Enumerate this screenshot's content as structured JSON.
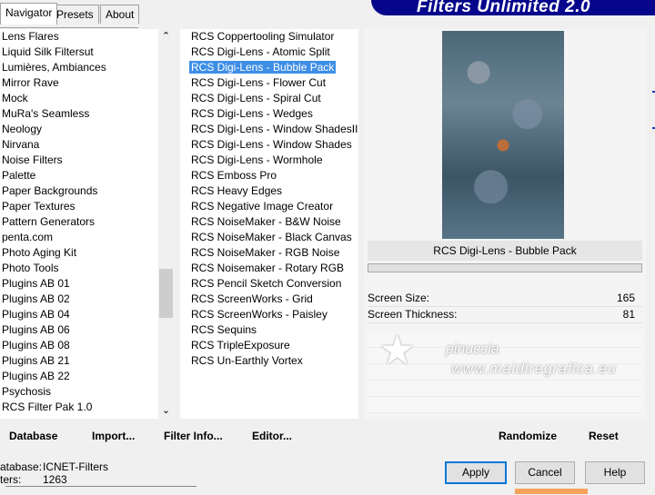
{
  "window": {
    "banner_title": "Filters Unlimited 2.0"
  },
  "tabs": [
    {
      "label": "Navigator",
      "active": true
    },
    {
      "label": "Presets",
      "active": false
    },
    {
      "label": "About",
      "active": false
    }
  ],
  "categories": [
    "Lens Flares",
    "Liquid Silk Filtersut",
    "Lumières, Ambiances",
    "Mirror Rave",
    "Mock",
    "MuRa's Seamless",
    "Neology",
    "Nirvana",
    "Noise Filters",
    "Palette",
    "Paper Backgrounds",
    "Paper Textures",
    "Pattern Generators",
    "penta.com",
    "Photo Aging Kit",
    "Photo Tools",
    "Plugins AB 01",
    "Plugins AB 02",
    "Plugins AB 04",
    "Plugins AB 06",
    "Plugins AB 08",
    "Plugins AB 21",
    "Plugins AB 22",
    "Psychosis",
    "RCS Filter Pak 1.0"
  ],
  "filters": [
    "RCS Coppertooling Simulator",
    "RCS Digi-Lens - Atomic Split",
    "RCS Digi-Lens - Bubble Pack",
    "RCS Digi-Lens - Flower Cut",
    "RCS Digi-Lens - Spiral Cut",
    "RCS Digi-Lens - Wedges",
    "RCS Digi-Lens - Window ShadesII",
    "RCS Digi-Lens - Window Shades",
    "RCS Digi-Lens - Wormhole",
    "RCS Emboss Pro",
    "RCS Heavy Edges",
    "RCS Negative Image Creator",
    "RCS NoiseMaker - B&W Noise",
    "RCS NoiseMaker - Black Canvas",
    "RCS NoiseMaker - RGB Noise",
    "RCS Noisemaker - Rotary RGB",
    "RCS Pencil Sketch Conversion",
    "RCS ScreenWorks - Grid",
    "RCS ScreenWorks - Paisley",
    "RCS Sequins",
    "RCS TripleExposure",
    "RCS Un-Earthly Vortex"
  ],
  "selected_filter_index": 2,
  "preview": {
    "filter_name": "RCS Digi-Lens - Bubble Pack",
    "params": [
      {
        "label": "Screen Size:",
        "value": "165"
      },
      {
        "label": "Screen Thickness:",
        "value": "81"
      }
    ]
  },
  "watermark": {
    "line1": "pinuccia",
    "line2": "www.maidiregrafica.eu"
  },
  "links": {
    "database": "Database",
    "import": "Import...",
    "filter_info": "Filter Info...",
    "editor": "Editor...",
    "randomize": "Randomize",
    "reset": "Reset"
  },
  "info": {
    "database_label": "atabase:",
    "database_value": "ICNET-Filters",
    "filters_label": "ters:",
    "filters_value": "1263"
  },
  "buttons": {
    "apply": "Apply",
    "cancel": "Cancel",
    "help": "Help"
  },
  "colors": {
    "banner": "#06068c",
    "selection": "#3d8ee5",
    "focus": "#0078d7"
  }
}
